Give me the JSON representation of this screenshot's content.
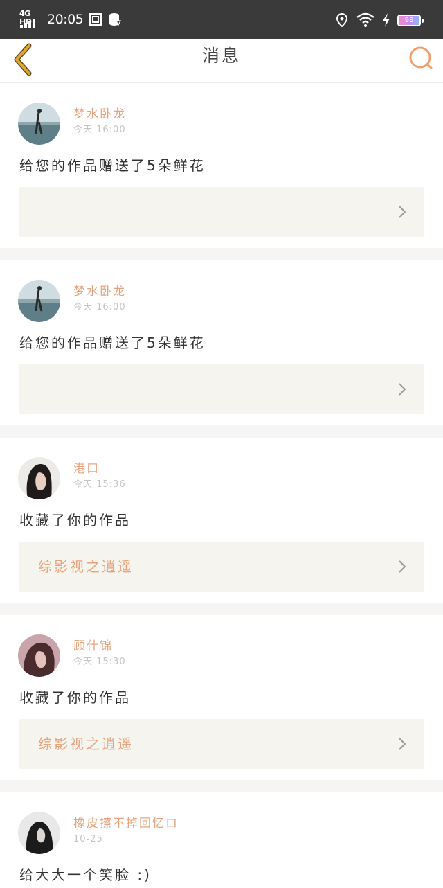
{
  "status_bar": {
    "network": "4G HD",
    "time": "20:05",
    "battery": "98",
    "icons": [
      "signal-icon",
      "screenshot-icon",
      "data-icon",
      "location-icon",
      "wifi-icon",
      "charging-icon",
      "battery-icon"
    ]
  },
  "nav": {
    "title": "消息",
    "back_icon": "chevron-left-icon",
    "search_icon": "search-icon",
    "colors": {
      "back": "#e0a830",
      "search": "#f0a070"
    }
  },
  "messages": [
    {
      "username": "梦水卧龙",
      "time": "今天 16:00",
      "text": "给您的作品赠送了5朵鲜花",
      "work_title": "",
      "avatar": "person-on-beach-avatar"
    },
    {
      "username": "梦水卧龙",
      "time": "今天 16:00",
      "text": "给您的作品赠送了5朵鲜花",
      "work_title": "",
      "avatar": "person-on-beach-avatar"
    },
    {
      "username": "港口",
      "time": "今天 15:36",
      "text": "收藏了你的作品",
      "work_title": "综影视之逍遥",
      "avatar": "dark-hair-woman-avatar"
    },
    {
      "username": "顾什锦",
      "time": "今天 15:30",
      "text": "收藏了你的作品",
      "work_title": "综影视之逍遥",
      "avatar": "pink-portrait-avatar"
    },
    {
      "username": "橡皮擦不掉回忆ロ",
      "time": "10-25",
      "text": "给大大一个笑脸 :)",
      "work_title": "",
      "avatar": "hooded-woman-avatar"
    }
  ],
  "colors": {
    "accent": "#e7a47e",
    "page_background": "#f6f5f4",
    "card_box": "#f5f4ee",
    "status_bar": "#3a3a3a"
  }
}
